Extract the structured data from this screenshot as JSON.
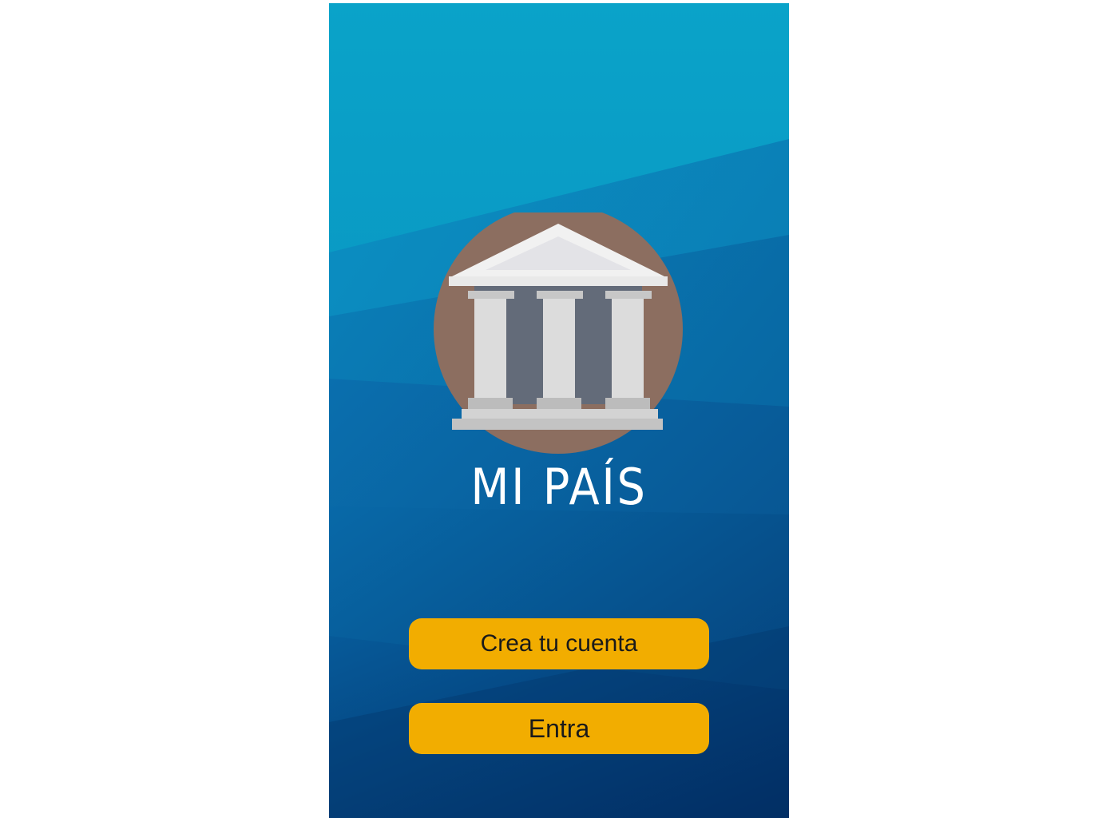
{
  "app": {
    "title": "MI PAÍS",
    "logo_icon": "government-building-icon"
  },
  "actions": {
    "create_account_label": "Crea tu cuenta",
    "login_label": "Entra"
  },
  "colors": {
    "button_bg": "#f2ad00",
    "button_text": "#1a1a1a",
    "title_text": "#ffffff",
    "logo_circle": "#8c6e60",
    "background_light": "#0aa0c8",
    "background_dark": "#032a62"
  }
}
